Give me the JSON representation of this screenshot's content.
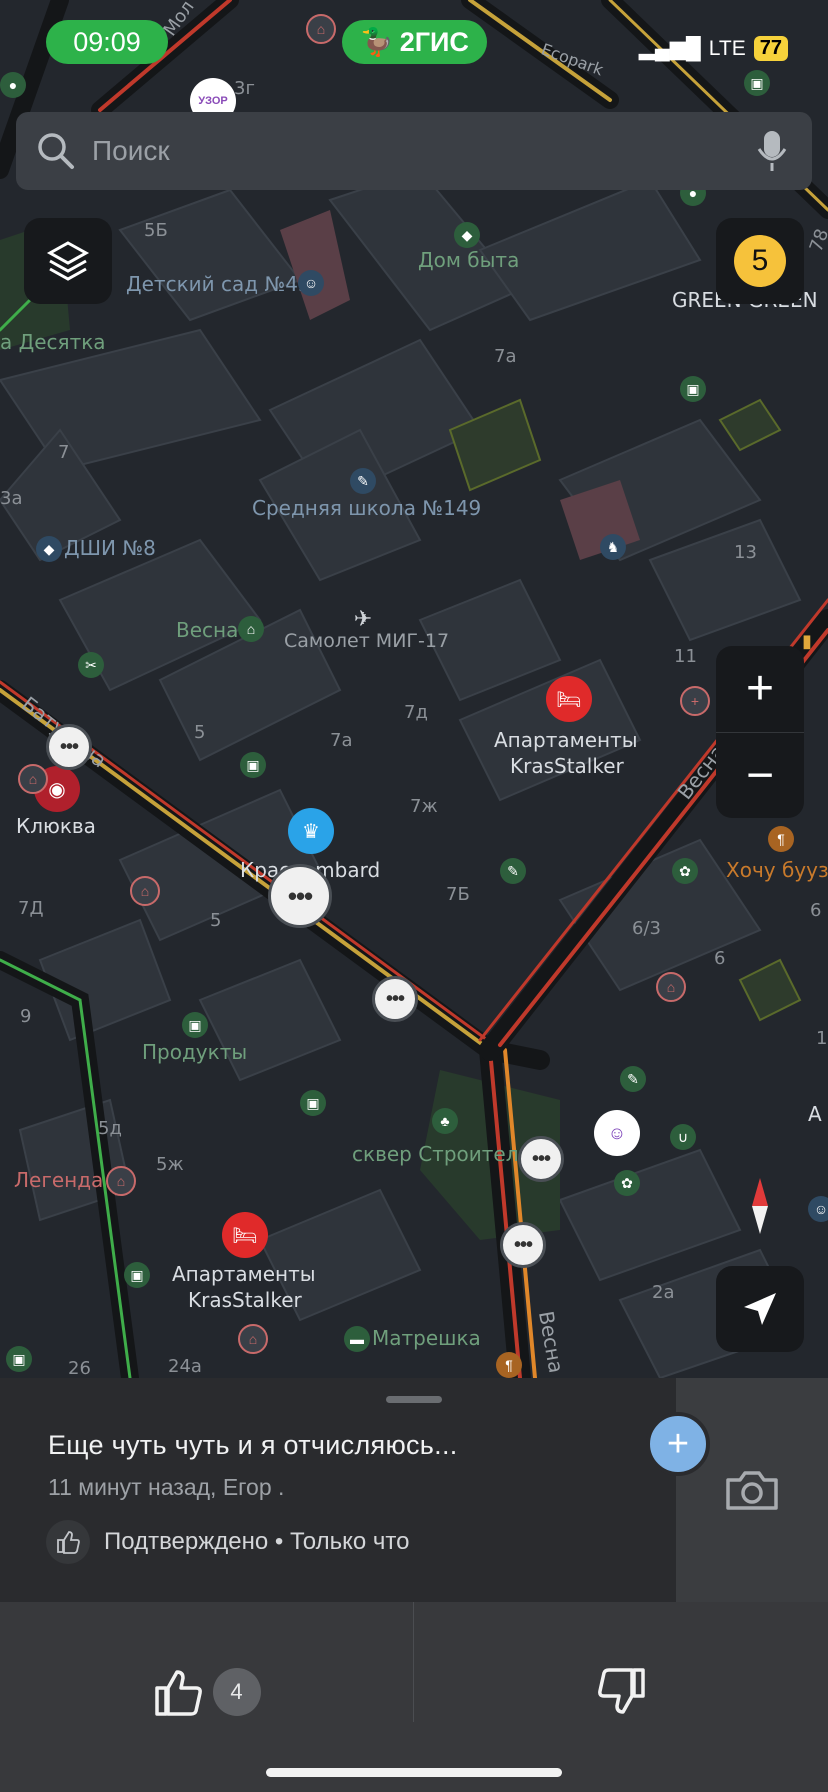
{
  "status": {
    "time": "09:09",
    "app_name": "2ГИС",
    "network": "LTE",
    "battery": "77"
  },
  "search": {
    "placeholder": "Поиск"
  },
  "layers_button": {
    "icon": "layers-icon"
  },
  "notification_badge": {
    "count": "5"
  },
  "zoom": {
    "in_label": "+",
    "out_label": "−"
  },
  "map": {
    "labels": {
      "dom_byta": "Дом быта",
      "green_green": "GREEN GREEN",
      "detsad": "Детский сад №43",
      "desyatka": "а Десятка",
      "school": "Средняя школа №149",
      "dshi": "ДШИ №8",
      "vesna": "Весна",
      "samolet": "Самолет МИГ-17",
      "apart1_line1": "Апартаменты",
      "apart1_line2": "KrasStalker",
      "klyukva": "Клюква",
      "kraslombard": "Краслombard",
      "khochu": "Хочу буузы",
      "produkty": "Продукты",
      "skver": "сквер Строителей",
      "legenda": "Легенда",
      "apart2_line1": "Апартаменты",
      "apart2_line2": "KrasStalker",
      "matreshka": "Матрешка",
      "uzor": "УЗОР",
      "ecopark": "Ecopark",
      "street_vesna": "Весна",
      "street_vesna2": "Весна",
      "street_bat": "Батурина",
      "street_mol": "Мол"
    },
    "numbers": {
      "n5b": "5Б",
      "n3g": "3г",
      "n7a_top": "7а",
      "n7": "7",
      "n3a": "3а",
      "n13": "13",
      "n11": "11",
      "n7d": "7д",
      "n7a_mid": "7а",
      "n5": "5",
      "n7zh": "7ж",
      "n7b": "7Б",
      "n6_3": "6/3",
      "n6": "6",
      "n6b": "6",
      "n7D": "7Д",
      "n5_mid": "5",
      "n9": "9",
      "n5d": "5д",
      "n5zh": "5ж",
      "n2a": "2а",
      "n26": "26",
      "n24a": "24а",
      "n78": "78",
      "n1": "1",
      "nA": "А"
    }
  },
  "sheet": {
    "title": "Еще чуть чуть и я отчисляюсь...",
    "meta": "11 минут назад, Егор .",
    "confirmed": "Подтверждено • Только что",
    "like_count": "4"
  },
  "colors": {
    "accent_green": "#2db24a",
    "badge_yellow": "#f6c23b",
    "add_blue": "#7fb2e5"
  }
}
